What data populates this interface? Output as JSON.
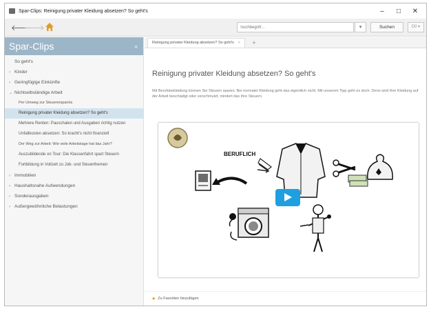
{
  "window": {
    "title": "Spar-Clips: Reinigung privater Kleidung absetzen? So geht's",
    "minimize": "–",
    "maximize": "□",
    "close": "✕"
  },
  "toolbar": {
    "back_icon": "back-arrow-icon",
    "forward_icon": "forward-arrow-icon",
    "home_icon": "home-icon",
    "search_placeholder": "Suchbegriff...",
    "search_dropdown": "▾",
    "search_button": "Suchen",
    "extra_button": "D0 ▾"
  },
  "sidebar": {
    "title": "Spar-Clips",
    "collapse": "«",
    "items": [
      {
        "label": "So geht's",
        "level": 0,
        "arrow": ""
      },
      {
        "label": "Kinder",
        "level": 0,
        "arrow": "›"
      },
      {
        "label": "Geringfügige Einkünfte",
        "level": 0,
        "arrow": "›"
      },
      {
        "label": "Nichtselbständige Arbeit",
        "level": 0,
        "arrow": "⌄"
      },
      {
        "label": "Per Umweg zur Steuerersparnis",
        "level": 1
      },
      {
        "label": "Reinigung privater Kleidung absetzen? So geht's",
        "level": 1,
        "active": true
      },
      {
        "label": "Mehrere Renten: Pauschalen und Ausgaben richtig nutzen",
        "level": 1
      },
      {
        "label": "Unfallkosten absetzen: So kracht's nicht finanziell",
        "level": 1
      },
      {
        "label": "Der Weg zur Arbeit: Wie viele Arbeitstage hat das Jahr?",
        "level": 1
      },
      {
        "label": "Auszubildende on Tour: Die Klassenfahrt spart Steuern",
        "level": 1
      },
      {
        "label": "Fortbildung in Vollzeit zu Job- und Steuerthemen",
        "level": 1
      },
      {
        "label": "Immobilien",
        "level": 0,
        "arrow": "›"
      },
      {
        "label": "Haushaltsnahe Aufwendungen",
        "level": 0,
        "arrow": "›"
      },
      {
        "label": "Sonderausgaben",
        "level": 0,
        "arrow": "›"
      },
      {
        "label": "Außergewöhnliche Belastungen",
        "level": 0,
        "arrow": "›"
      }
    ]
  },
  "tabs": [
    {
      "label": "Reinigung privater Kleidung absetzen? So geht's",
      "close": "×"
    }
  ],
  "tab_add": "+",
  "main": {
    "title": "Reinigung privater Kleidung absetzen? So geht's",
    "intro": "Mit Berufsbekleidung können Sie Steuern sparen. Bei normaler Kleidung geht das eigentlich nicht. Mit unserem Tipp geht es doch. Denn wird Ihre Kleidung auf der Arbeit beschädigt oder verschmutzt, mindert das Ihre Steuern.",
    "video": {
      "label": "BERUFLICH",
      "play_icon": "play-icon",
      "accent": "#1e9fe0"
    },
    "favorite_link": "Zu Favoriten hinzufügen",
    "favorite_icon": "star-icon"
  }
}
